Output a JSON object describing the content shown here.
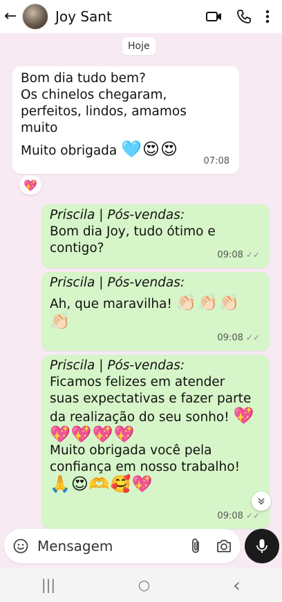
{
  "header": {
    "back_glyph": "←",
    "contact_name": "Joy Sant",
    "icons": [
      "video-call-icon",
      "phone-icon",
      "more-options-icon"
    ]
  },
  "date_separator": "Hoje",
  "messages": [
    {
      "direction": "incoming",
      "text": "Bom dia tudo bem?\nOs chinelos chegaram,\nperfeitos, lindos, amamos\nmuito",
      "text2": "Muito obrigada",
      "emojis": "🩵😍😍",
      "time": "07:08",
      "reaction": "💖"
    },
    {
      "direction": "outgoing",
      "sender": "Priscila | Pós-vendas:",
      "text": "Bom dia Joy, tudo ótimo e\ncontigo?",
      "time": "09:08",
      "ticks": "✓✓"
    },
    {
      "direction": "outgoing",
      "sender": "Priscila | Pós-vendas:",
      "text": "Ah, que maravilha!",
      "emojis": "👏🏻👏🏻👏🏻",
      "emojis2": "👏🏻",
      "time": "09:08",
      "ticks": "✓✓"
    },
    {
      "direction": "outgoing",
      "sender": "Priscila | Pós-vendas:",
      "text": "Ficamos felizes em atender\nsuas expectativas e fazer parte\nda realização do seu sonho!",
      "emojis": "💖",
      "emojis2": "💖💖💖💖",
      "text2": "Muito obrigada você pela\nconfiança em nosso trabalho!",
      "emojis3": "🙏😍🫶🥰💖",
      "time": "09:08",
      "ticks": "✓✓"
    }
  ],
  "composer": {
    "placeholder": "Mensagem",
    "icons": [
      "emoji-icon",
      "attach-icon",
      "camera-icon",
      "mic-icon"
    ]
  },
  "navbar": {
    "recents": "|||",
    "home": "○",
    "back": "‹"
  },
  "colors": {
    "chat_background": "#f7eaf3",
    "outgoing_bubble": "#d6f5c8",
    "incoming_bubble": "#ffffff"
  }
}
